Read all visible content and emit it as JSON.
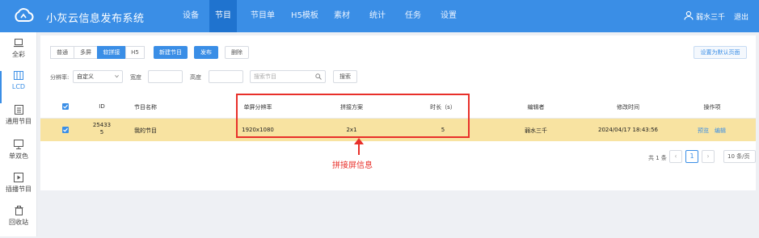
{
  "app": {
    "title": "小灰云信息发布系统"
  },
  "nav": {
    "items": [
      {
        "label": "设备"
      },
      {
        "label": "节目"
      },
      {
        "label": "节目单"
      },
      {
        "label": "H5模板"
      },
      {
        "label": "素材"
      },
      {
        "label": "统计"
      },
      {
        "label": "任务"
      },
      {
        "label": "设置"
      }
    ],
    "active": "节目"
  },
  "user": {
    "name": "弱水三千",
    "logout": "退出"
  },
  "sidebar": {
    "items": [
      {
        "label": "全彩",
        "icon": "laptop-icon"
      },
      {
        "label": "LCD",
        "icon": "lcd-icon"
      },
      {
        "label": "通用节目",
        "icon": "document-icon"
      },
      {
        "label": "单双色",
        "icon": "monitor-icon"
      },
      {
        "label": "插播节目",
        "icon": "play-icon"
      },
      {
        "label": "回收站",
        "icon": "trash-icon"
      }
    ],
    "active": "LCD"
  },
  "toolbar": {
    "modes": [
      "普通",
      "多屏",
      "软拼接",
      "H5"
    ],
    "active_mode": "软拼接",
    "new_label": "新建节目",
    "publish_label": "发布",
    "delete_label": "删除",
    "default_page_label": "设置为默认页面"
  },
  "filter": {
    "resolution_label": "分辨率:",
    "resolution_value": "自定义",
    "width_label": "宽度",
    "height_label": "高度",
    "search_placeholder": "搜索节目",
    "search_button": "搜索"
  },
  "table": {
    "headers": [
      "ID",
      "节目名称",
      "单屏分辨率",
      "拼接方案",
      "时长（s）",
      "编辑者",
      "修改时间",
      "操作项"
    ],
    "rows": [
      {
        "id_line1": "25433",
        "id_line2": "5",
        "name": "我的节目",
        "resolution": "1920x1080",
        "scheme": "2x1",
        "duration": "5",
        "editor": "弱水三千",
        "modified": "2024/04/17 18:43:56",
        "action_preview": "预览",
        "action_edit": "编辑"
      }
    ]
  },
  "pagination": {
    "total": "共 1 条",
    "current": "1",
    "page_size": "10 条/页"
  },
  "annotation": {
    "text": "拼接屏信息",
    "color": "#e8302a"
  },
  "colors": {
    "brand": "#3a8ee6",
    "row_highlight": "#f8e3a1"
  }
}
